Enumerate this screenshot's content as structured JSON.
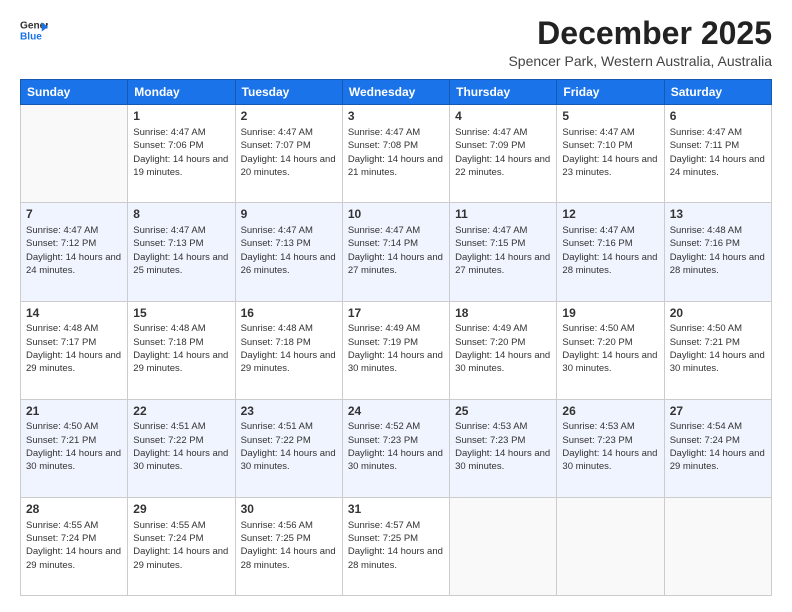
{
  "header": {
    "logo_line1": "General",
    "logo_line2": "Blue",
    "title": "December 2025",
    "subtitle": "Spencer Park, Western Australia, Australia"
  },
  "days_of_week": [
    "Sunday",
    "Monday",
    "Tuesday",
    "Wednesday",
    "Thursday",
    "Friday",
    "Saturday"
  ],
  "weeks": [
    [
      {
        "num": "",
        "sunrise": "",
        "sunset": "",
        "daylight": ""
      },
      {
        "num": "1",
        "sunrise": "Sunrise: 4:47 AM",
        "sunset": "Sunset: 7:06 PM",
        "daylight": "Daylight: 14 hours and 19 minutes."
      },
      {
        "num": "2",
        "sunrise": "Sunrise: 4:47 AM",
        "sunset": "Sunset: 7:07 PM",
        "daylight": "Daylight: 14 hours and 20 minutes."
      },
      {
        "num": "3",
        "sunrise": "Sunrise: 4:47 AM",
        "sunset": "Sunset: 7:08 PM",
        "daylight": "Daylight: 14 hours and 21 minutes."
      },
      {
        "num": "4",
        "sunrise": "Sunrise: 4:47 AM",
        "sunset": "Sunset: 7:09 PM",
        "daylight": "Daylight: 14 hours and 22 minutes."
      },
      {
        "num": "5",
        "sunrise": "Sunrise: 4:47 AM",
        "sunset": "Sunset: 7:10 PM",
        "daylight": "Daylight: 14 hours and 23 minutes."
      },
      {
        "num": "6",
        "sunrise": "Sunrise: 4:47 AM",
        "sunset": "Sunset: 7:11 PM",
        "daylight": "Daylight: 14 hours and 24 minutes."
      }
    ],
    [
      {
        "num": "7",
        "sunrise": "Sunrise: 4:47 AM",
        "sunset": "Sunset: 7:12 PM",
        "daylight": "Daylight: 14 hours and 24 minutes."
      },
      {
        "num": "8",
        "sunrise": "Sunrise: 4:47 AM",
        "sunset": "Sunset: 7:13 PM",
        "daylight": "Daylight: 14 hours and 25 minutes."
      },
      {
        "num": "9",
        "sunrise": "Sunrise: 4:47 AM",
        "sunset": "Sunset: 7:13 PM",
        "daylight": "Daylight: 14 hours and 26 minutes."
      },
      {
        "num": "10",
        "sunrise": "Sunrise: 4:47 AM",
        "sunset": "Sunset: 7:14 PM",
        "daylight": "Daylight: 14 hours and 27 minutes."
      },
      {
        "num": "11",
        "sunrise": "Sunrise: 4:47 AM",
        "sunset": "Sunset: 7:15 PM",
        "daylight": "Daylight: 14 hours and 27 minutes."
      },
      {
        "num": "12",
        "sunrise": "Sunrise: 4:47 AM",
        "sunset": "Sunset: 7:16 PM",
        "daylight": "Daylight: 14 hours and 28 minutes."
      },
      {
        "num": "13",
        "sunrise": "Sunrise: 4:48 AM",
        "sunset": "Sunset: 7:16 PM",
        "daylight": "Daylight: 14 hours and 28 minutes."
      }
    ],
    [
      {
        "num": "14",
        "sunrise": "Sunrise: 4:48 AM",
        "sunset": "Sunset: 7:17 PM",
        "daylight": "Daylight: 14 hours and 29 minutes."
      },
      {
        "num": "15",
        "sunrise": "Sunrise: 4:48 AM",
        "sunset": "Sunset: 7:18 PM",
        "daylight": "Daylight: 14 hours and 29 minutes."
      },
      {
        "num": "16",
        "sunrise": "Sunrise: 4:48 AM",
        "sunset": "Sunset: 7:18 PM",
        "daylight": "Daylight: 14 hours and 29 minutes."
      },
      {
        "num": "17",
        "sunrise": "Sunrise: 4:49 AM",
        "sunset": "Sunset: 7:19 PM",
        "daylight": "Daylight: 14 hours and 30 minutes."
      },
      {
        "num": "18",
        "sunrise": "Sunrise: 4:49 AM",
        "sunset": "Sunset: 7:20 PM",
        "daylight": "Daylight: 14 hours and 30 minutes."
      },
      {
        "num": "19",
        "sunrise": "Sunrise: 4:50 AM",
        "sunset": "Sunset: 7:20 PM",
        "daylight": "Daylight: 14 hours and 30 minutes."
      },
      {
        "num": "20",
        "sunrise": "Sunrise: 4:50 AM",
        "sunset": "Sunset: 7:21 PM",
        "daylight": "Daylight: 14 hours and 30 minutes."
      }
    ],
    [
      {
        "num": "21",
        "sunrise": "Sunrise: 4:50 AM",
        "sunset": "Sunset: 7:21 PM",
        "daylight": "Daylight: 14 hours and 30 minutes."
      },
      {
        "num": "22",
        "sunrise": "Sunrise: 4:51 AM",
        "sunset": "Sunset: 7:22 PM",
        "daylight": "Daylight: 14 hours and 30 minutes."
      },
      {
        "num": "23",
        "sunrise": "Sunrise: 4:51 AM",
        "sunset": "Sunset: 7:22 PM",
        "daylight": "Daylight: 14 hours and 30 minutes."
      },
      {
        "num": "24",
        "sunrise": "Sunrise: 4:52 AM",
        "sunset": "Sunset: 7:23 PM",
        "daylight": "Daylight: 14 hours and 30 minutes."
      },
      {
        "num": "25",
        "sunrise": "Sunrise: 4:53 AM",
        "sunset": "Sunset: 7:23 PM",
        "daylight": "Daylight: 14 hours and 30 minutes."
      },
      {
        "num": "26",
        "sunrise": "Sunrise: 4:53 AM",
        "sunset": "Sunset: 7:23 PM",
        "daylight": "Daylight: 14 hours and 30 minutes."
      },
      {
        "num": "27",
        "sunrise": "Sunrise: 4:54 AM",
        "sunset": "Sunset: 7:24 PM",
        "daylight": "Daylight: 14 hours and 29 minutes."
      }
    ],
    [
      {
        "num": "28",
        "sunrise": "Sunrise: 4:55 AM",
        "sunset": "Sunset: 7:24 PM",
        "daylight": "Daylight: 14 hours and 29 minutes."
      },
      {
        "num": "29",
        "sunrise": "Sunrise: 4:55 AM",
        "sunset": "Sunset: 7:24 PM",
        "daylight": "Daylight: 14 hours and 29 minutes."
      },
      {
        "num": "30",
        "sunrise": "Sunrise: 4:56 AM",
        "sunset": "Sunset: 7:25 PM",
        "daylight": "Daylight: 14 hours and 28 minutes."
      },
      {
        "num": "31",
        "sunrise": "Sunrise: 4:57 AM",
        "sunset": "Sunset: 7:25 PM",
        "daylight": "Daylight: 14 hours and 28 minutes."
      },
      {
        "num": "",
        "sunrise": "",
        "sunset": "",
        "daylight": ""
      },
      {
        "num": "",
        "sunrise": "",
        "sunset": "",
        "daylight": ""
      },
      {
        "num": "",
        "sunrise": "",
        "sunset": "",
        "daylight": ""
      }
    ]
  ]
}
